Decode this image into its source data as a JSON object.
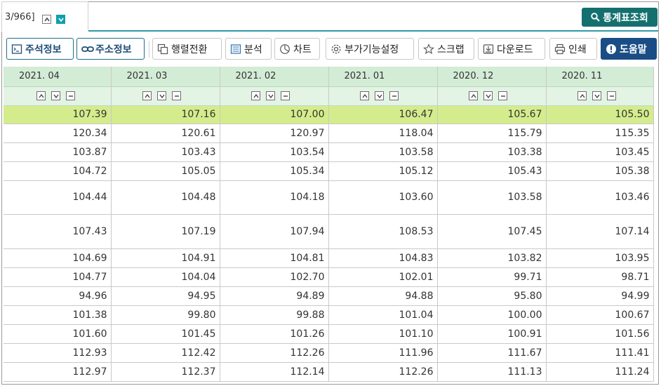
{
  "tab": {
    "text": "3/966]"
  },
  "stat_button": {
    "label": "통계표조회"
  },
  "toolbar": {
    "annotation": "주석정보",
    "address": "주소정보",
    "transpose": "행렬전환",
    "analysis": "분석",
    "chart": "차트",
    "addon": "부가기능설정",
    "scrap": "스크랩",
    "download": "다운로드",
    "print": "인쇄",
    "help": "도움말"
  },
  "columns": [
    "2021. 04",
    "2021. 03",
    "2021. 02",
    "2021. 01",
    "2020. 12",
    "2020. 11"
  ],
  "rows": [
    [
      "107.39",
      "107.16",
      "107.00",
      "106.47",
      "105.67",
      "105.50"
    ],
    [
      "120.34",
      "120.61",
      "120.97",
      "118.04",
      "115.79",
      "115.35"
    ],
    [
      "103.87",
      "103.43",
      "103.54",
      "103.58",
      "103.38",
      "103.45"
    ],
    [
      "104.72",
      "105.05",
      "105.34",
      "105.12",
      "105.43",
      "105.38"
    ],
    [
      "104.44",
      "104.48",
      "104.18",
      "103.60",
      "103.58",
      "103.46"
    ],
    [
      "107.43",
      "107.19",
      "107.94",
      "108.53",
      "107.45",
      "107.14"
    ],
    [
      "104.69",
      "104.91",
      "104.81",
      "104.83",
      "103.82",
      "103.95"
    ],
    [
      "104.77",
      "104.04",
      "102.70",
      "102.01",
      "99.71",
      "98.71"
    ],
    [
      "94.96",
      "94.95",
      "94.89",
      "94.88",
      "95.80",
      "94.99"
    ],
    [
      "101.38",
      "99.80",
      "99.88",
      "101.04",
      "100.00",
      "100.67"
    ],
    [
      "101.60",
      "101.45",
      "101.26",
      "101.10",
      "100.91",
      "101.56"
    ],
    [
      "112.93",
      "112.42",
      "112.26",
      "111.96",
      "111.67",
      "111.41"
    ],
    [
      "112.97",
      "112.37",
      "112.14",
      "112.26",
      "111.13",
      "111.24"
    ]
  ],
  "colors": {
    "accent": "#14706f",
    "header_bg": "#d3ecd5",
    "highlight_row": "#d4ec8c",
    "help_bg": "#1a4d86"
  }
}
